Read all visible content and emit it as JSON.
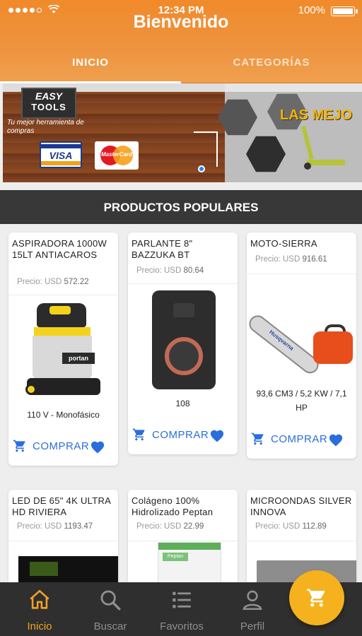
{
  "status_bar": {
    "time": "12:34 PM",
    "battery": "100%"
  },
  "header": {
    "title": "Bienvenido"
  },
  "tabs": [
    {
      "label": "INICIO",
      "active": true
    },
    {
      "label": "CATEGORÍAS",
      "active": false
    }
  ],
  "banner": {
    "left": {
      "logo_line1": "EASY",
      "logo_line2": "TOOLS",
      "tagline": "Tu mejor herramienta de compras",
      "card1": "VISA",
      "card2": "MasterCard"
    },
    "right": {
      "title": "LAS MEJO"
    }
  },
  "section": {
    "title": "PRODUCTOS POPULARES"
  },
  "products": [
    {
      "name": "ASPIRADORA 1000W 15LT ANTIACAROS",
      "price_label": "Precio: USD",
      "price": "572.22",
      "spec": "110 V - Monofásico",
      "brand": "portan",
      "buy_label": "COMPRAR"
    },
    {
      "name": "PARLANTE 8\" BAZZUKA BT",
      "price_label": "Precio: USD",
      "price": "80.64",
      "spec": "108",
      "buy_label": "COMPRAR"
    },
    {
      "name": "MOTO-SIERRA",
      "price_label": "Precio: USD",
      "price": "916.61",
      "spec": "93,6 CM3 / 5,2 KW / 7,1 HP",
      "buy_label": "COMPRAR"
    },
    {
      "name": "LED DE 65\" 4K ULTRA HD RIVIERA",
      "price_label": "Precio: USD",
      "price": "1193.47"
    },
    {
      "name": "Colágeno 100% Hidrolizado Peptan",
      "price_label": "Precio: USD",
      "price": "22.99",
      "pack_label": "Peptan"
    },
    {
      "name": "MICROONDAS SILVER INNOVA",
      "price_label": "Precio: USD",
      "price": "112.89"
    }
  ],
  "nav": [
    {
      "label": "Inicio",
      "icon": "home-icon",
      "active": true
    },
    {
      "label": "Buscar",
      "icon": "search-icon",
      "active": false
    },
    {
      "label": "Favoritos",
      "icon": "list-icon",
      "active": false
    },
    {
      "label": "Perfil",
      "icon": "user-icon",
      "active": false
    }
  ],
  "colors": {
    "primary": "#F08A2A",
    "accent_blue": "#2A6EDB",
    "dark": "#2F2F2F",
    "fab": "#F5B21E"
  }
}
